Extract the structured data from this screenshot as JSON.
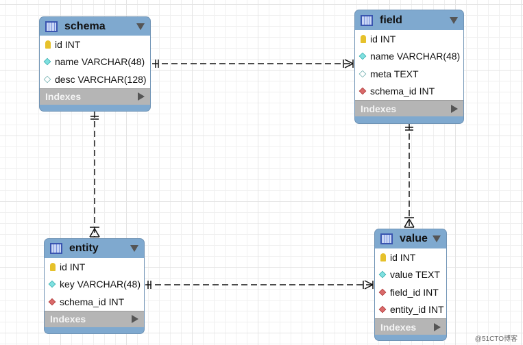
{
  "tables": {
    "schema": {
      "name": "schema",
      "rows": [
        {
          "icon": "key-icon",
          "text": "id INT"
        },
        {
          "icon": "diamond-filled-icon",
          "text": "name VARCHAR(48)"
        },
        {
          "icon": "diamond-empty-icon",
          "text": "desc VARCHAR(128)"
        }
      ],
      "indexes": "Indexes"
    },
    "field": {
      "name": "field",
      "rows": [
        {
          "icon": "key-icon",
          "text": "id INT"
        },
        {
          "icon": "diamond-filled-icon",
          "text": "name VARCHAR(48)"
        },
        {
          "icon": "diamond-empty-icon",
          "text": "meta TEXT"
        },
        {
          "icon": "diamond-red-icon",
          "text": "schema_id INT"
        }
      ],
      "indexes": "Indexes"
    },
    "entity": {
      "name": "entity",
      "rows": [
        {
          "icon": "key-icon",
          "text": "id INT"
        },
        {
          "icon": "diamond-filled-icon",
          "text": "key VARCHAR(48)"
        },
        {
          "icon": "diamond-red-icon",
          "text": "schema_id INT"
        }
      ],
      "indexes": "Indexes"
    },
    "value": {
      "name": "value",
      "rows": [
        {
          "icon": "key-icon",
          "text": "id INT"
        },
        {
          "icon": "diamond-filled-icon",
          "text": "value TEXT"
        },
        {
          "icon": "diamond-red-icon",
          "text": "field_id INT"
        },
        {
          "icon": "diamond-red-icon",
          "text": "entity_id INT"
        }
      ],
      "indexes": "Indexes"
    }
  },
  "relationships": [
    {
      "from": "schema",
      "to": "field",
      "type": "one-to-many"
    },
    {
      "from": "schema",
      "to": "entity",
      "type": "one-to-many"
    },
    {
      "from": "field",
      "to": "value",
      "type": "one-to-many"
    },
    {
      "from": "entity",
      "to": "value",
      "type": "one-to-many"
    }
  ],
  "watermark": "@51CTO博客"
}
